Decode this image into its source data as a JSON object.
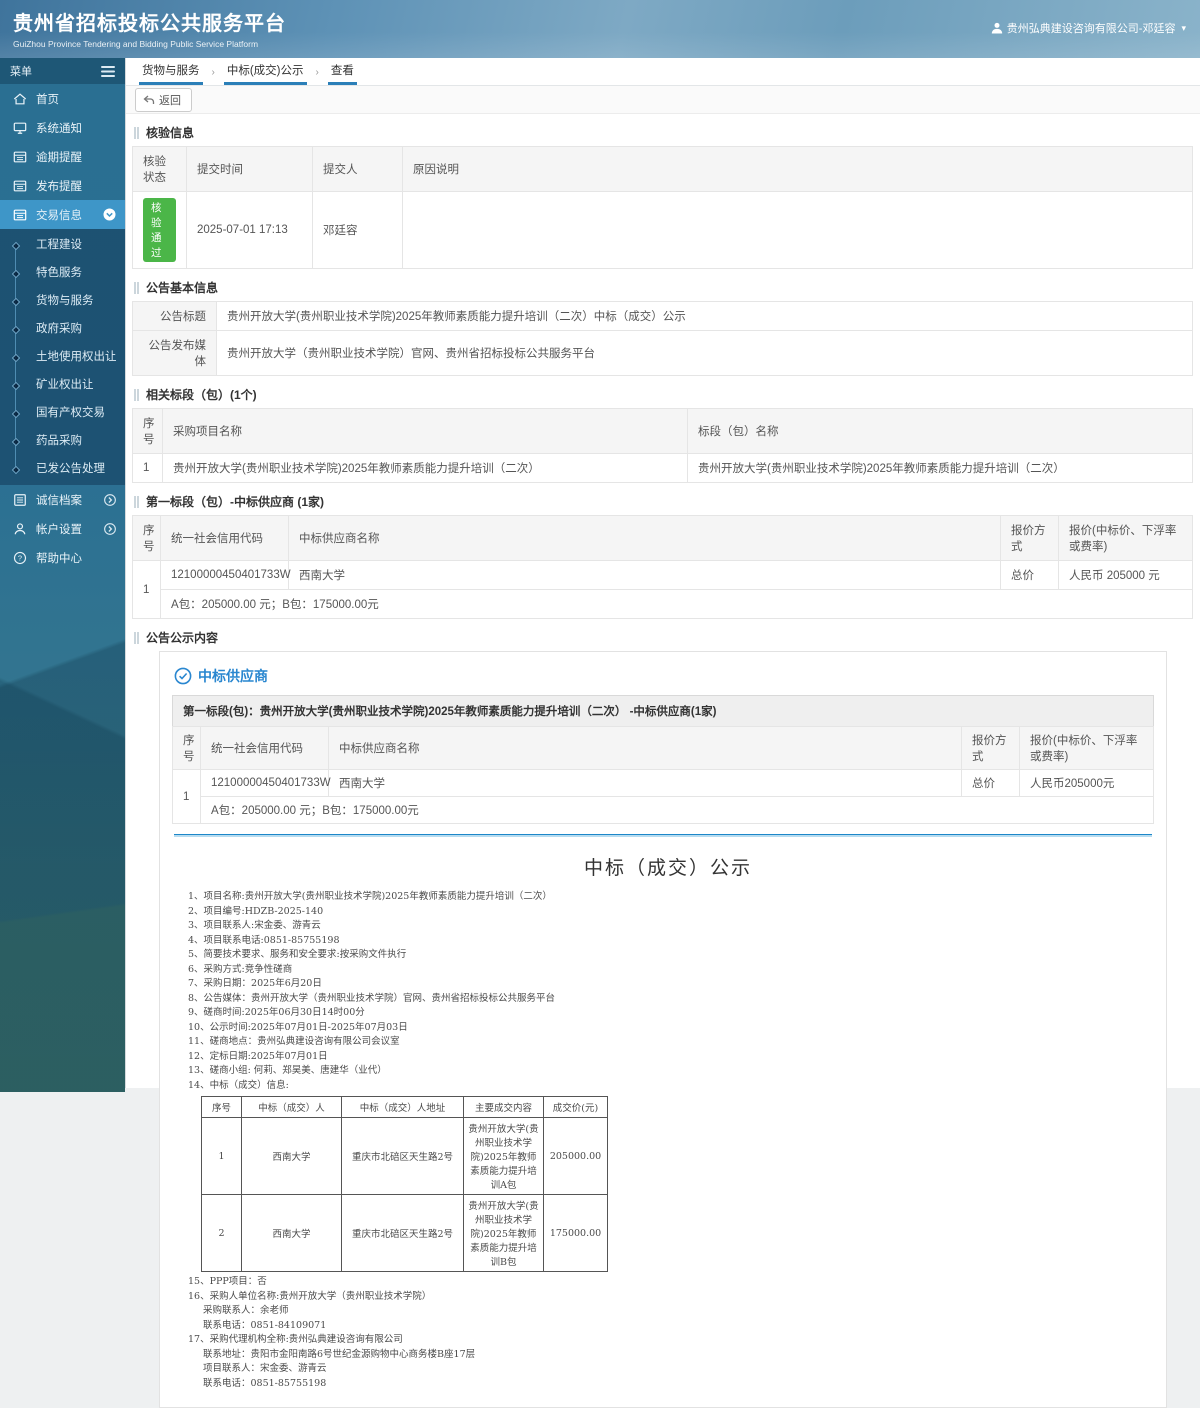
{
  "colors": {
    "accent": "#1e88c9",
    "active_nav": "#3e96c8",
    "badge_green": "#4bb648",
    "crumb_underline": "#2b7fb8"
  },
  "header": {
    "title": "贵州省招标投标公共服务平台",
    "subtitle": "GuiZhou Province Tendering and Bidding Public Service Platform",
    "user": "贵州弘典建设咨询有限公司-邓廷容",
    "caret": "▾"
  },
  "sidebar": {
    "menu_label": "菜单",
    "items": [
      {
        "label": "首页",
        "icon": "home-icon"
      },
      {
        "label": "系统通知",
        "icon": "monitor-icon"
      },
      {
        "label": "逾期提醒",
        "icon": "folder-icon"
      },
      {
        "label": "发布提醒",
        "icon": "folder-icon"
      },
      {
        "label": "交易信息",
        "icon": "folder-icon"
      }
    ],
    "submenu": [
      "工程建设",
      "特色服务",
      "货物与服务",
      "政府采购",
      "土地使用权出让",
      "矿业权出让",
      "国有产权交易",
      "药品采购",
      "已发公告处理"
    ],
    "bottom": [
      "诚信档案",
      "帐户设置",
      "帮助中心"
    ]
  },
  "breadcrumb": {
    "items": [
      "货物与服务",
      "中标(成交)公示",
      "查看"
    ],
    "sep": "›"
  },
  "toolbar": {
    "back": "返回"
  },
  "verify": {
    "title": "核验信息",
    "headers": [
      "核验状态",
      "提交时间",
      "提交人",
      "原因说明"
    ],
    "status": "核验通过",
    "time": "2025-07-01 17:13",
    "submitter": "邓廷容",
    "reason": ""
  },
  "basic": {
    "title": "公告基本信息",
    "label1": "公告标题",
    "value1": "贵州开放大学(贵州职业技术学院)2025年教师素质能力提升培训（二次）中标（成交）公示",
    "label2": "公告发布媒体",
    "value2": "贵州开放大学（贵州职业技术学院）官网、贵州省招标投标公共服务平台"
  },
  "related": {
    "title": "相关标段（包）(1个)",
    "headers": [
      "序号",
      "采购项目名称",
      "标段（包）名称"
    ],
    "rows": [
      [
        "1",
        "贵州开放大学(贵州职业技术学院)2025年教师素质能力提升培训（二次）",
        "贵州开放大学(贵州职业技术学院)2025年教师素质能力提升培训（二次）"
      ]
    ]
  },
  "supplier": {
    "title": "第一标段（包）-中标供应商 (1家)",
    "headers": [
      "序号",
      "统一社会信用代码",
      "中标供应商名称",
      "报价方式",
      "报价(中标价、下浮率或费率)"
    ],
    "no": "1",
    "code": "12100000450401733W",
    "name": "西南大学",
    "method": "总价",
    "price": "人民币 205000 元",
    "detail": "A包：205000.00 元；B包：175000.00元"
  },
  "notice": {
    "title": "公告公示内容",
    "supplier_heading": "中标供应商",
    "box_title": "第一标段(包)：贵州开放大学(贵州职业技术学院)2025年教师素质能力提升培训（二次） -中标供应商(1家)",
    "table": {
      "headers": [
        "序号",
        "统一社会信用代码",
        "中标供应商名称",
        "报价方式",
        "报价(中标价、下浮率或费率)"
      ],
      "no": "1",
      "code": "12100000450401733W",
      "name": "西南大学",
      "method": "总价",
      "price": "人民币205000元",
      "detail": "A包：205000.00 元；B包：175000.00元"
    },
    "doc_title": "中标（成交）公示",
    "lines_before": [
      "1、项目名称:贵州开放大学(贵州职业技术学院)2025年教师素质能力提升培训（二次）",
      "2、项目编号:HDZB-2025-140",
      "3、项目联系人:宋金委、游青云",
      "4、项目联系电话:0851-85755198",
      "5、简要技术要求、服务和安全要求:按采购文件执行",
      "6、采购方式:竞争性磋商",
      "7、采购日期：2025年6月20日",
      "8、公告媒体：贵州开放大学（贵州职业技术学院）官网、贵州省招标投标公共服务平台",
      "9、磋商时间:2025年06月30日14时00分",
      "10、公示时间:2025年07月01日-2025年07月03日",
      "11、磋商地点：贵州弘典建设咨询有限公司会议室",
      "12、定标日期:2025年07月01日",
      "13、磋商小组: 何莉、郑昊美、唐建华（业代）",
      "14、中标（成交）信息:"
    ],
    "award": {
      "headers": [
        "序号",
        "中标（成交）人",
        "中标（成交）人地址",
        "主要成交内容",
        "成交价(元)"
      ],
      "rows": [
        [
          "1",
          "西南大学",
          "重庆市北碚区天生路2号",
          "贵州开放大学(贵州职业技术学院)2025年教师素质能力提升培训A包",
          "205000.00"
        ],
        [
          "2",
          "西南大学",
          "重庆市北碚区天生路2号",
          "贵州开放大学(贵州职业技术学院)2025年教师素质能力提升培训B包",
          "175000.00"
        ]
      ]
    },
    "lines_after": [
      "15、PPP项目：否",
      "16、采购人单位名称:贵州开放大学（贵州职业技术学院）",
      "采购联系人：余老师",
      "联系电话：0851-84109071",
      "17、采购代理机构全称:贵州弘典建设咨询有限公司",
      "联系地址：贵阳市金阳南路6号世纪金源购物中心商务楼B座17层",
      "项目联系人：宋金委、游青云",
      "联系电话：0851-85755198"
    ]
  }
}
